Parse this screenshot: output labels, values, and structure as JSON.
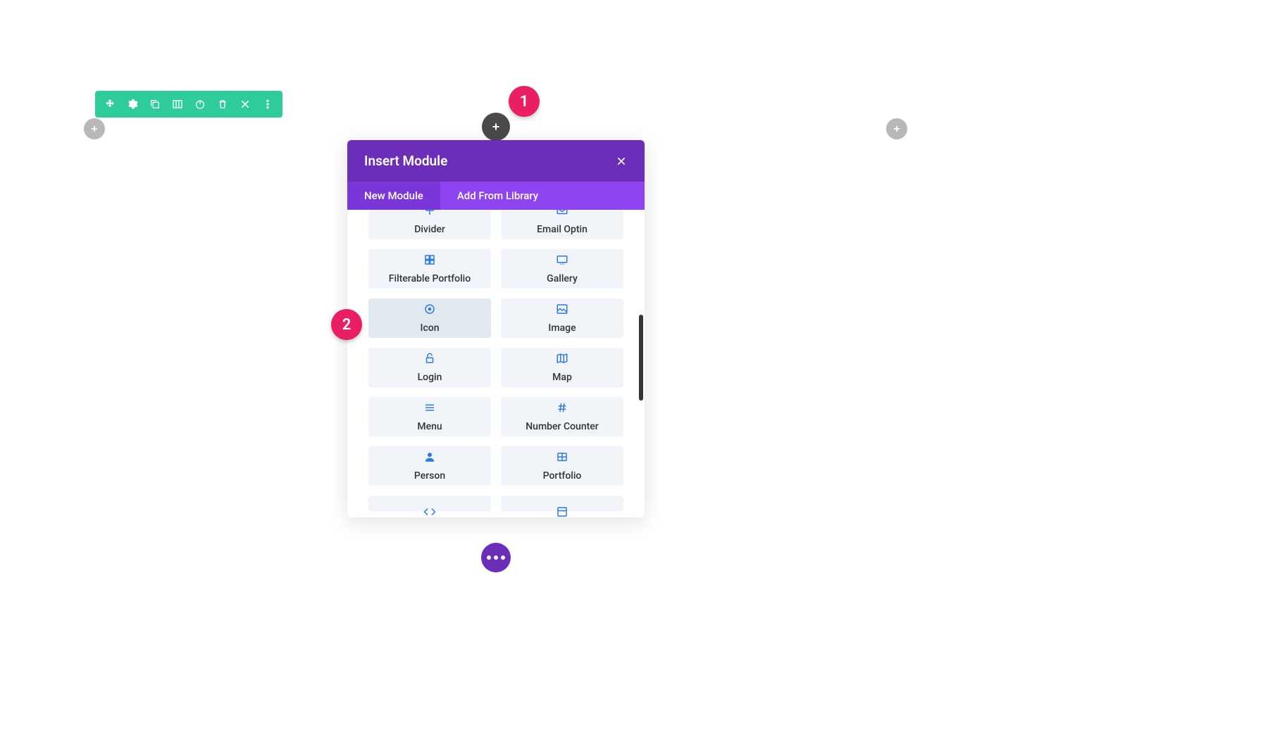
{
  "modal": {
    "title": "Insert Module",
    "tabs": {
      "new_module": "New Module",
      "add_from_library": "Add From Library"
    }
  },
  "modules": {
    "divider": "Divider",
    "email_optin": "Email Optin",
    "filterable_portfolio": "Filterable Portfolio",
    "gallery": "Gallery",
    "icon": "Icon",
    "image": "Image",
    "login": "Login",
    "map": "Map",
    "menu": "Menu",
    "number_counter": "Number Counter",
    "person": "Person",
    "portfolio": "Portfolio"
  },
  "annotations": {
    "one": "1",
    "two": "2"
  }
}
